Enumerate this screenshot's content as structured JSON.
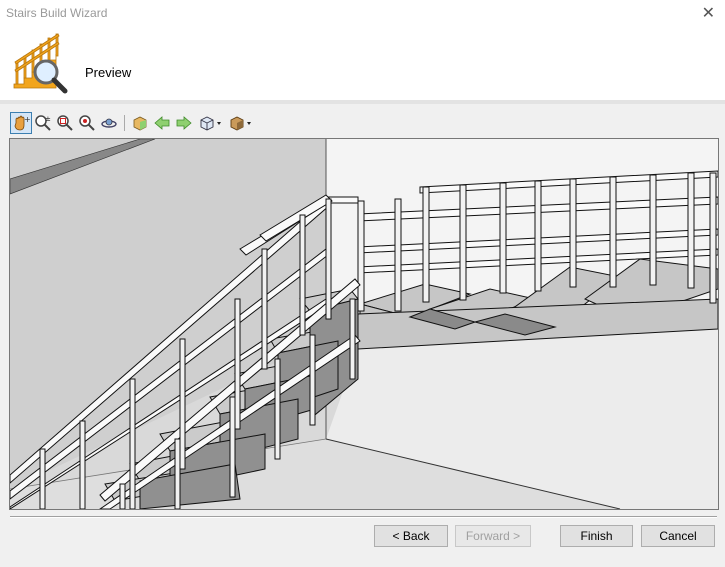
{
  "window": {
    "title": "Stairs Build Wizard",
    "close_symbol": "✕"
  },
  "header": {
    "caption": "Preview",
    "logo_icon": "stairs-magnifier-icon"
  },
  "toolbar": {
    "icons": [
      "pan-icon",
      "zoom-dynamic-icon",
      "zoom-window-icon",
      "zoom-extents-icon",
      "orbit-icon",
      "render-mode-icon",
      "previous-view-icon",
      "next-view-icon",
      "view-cube-icon",
      "box-display-icon"
    ]
  },
  "buttons": {
    "back": "< Back",
    "forward": "Forward >",
    "finish": "Finish",
    "cancel": "Cancel"
  }
}
